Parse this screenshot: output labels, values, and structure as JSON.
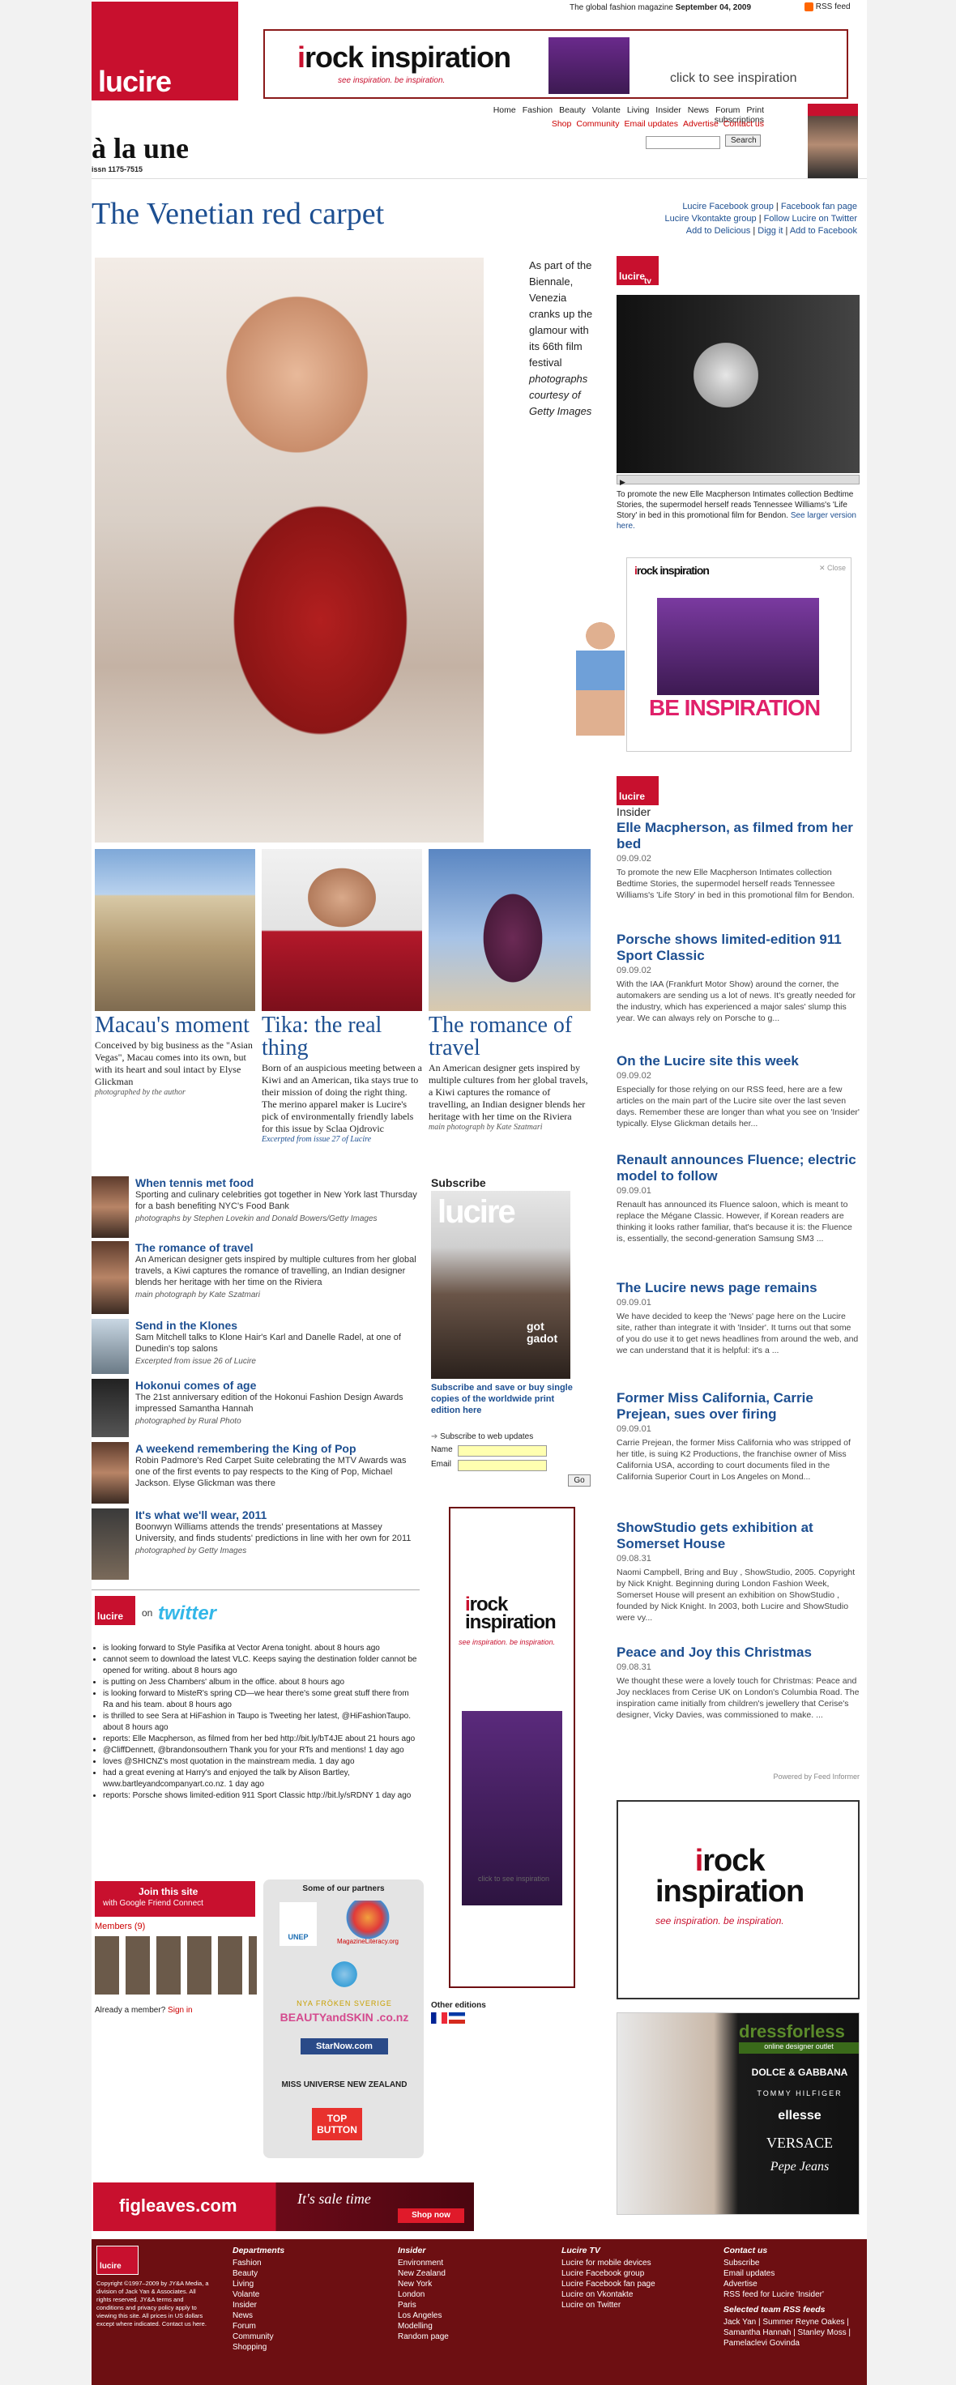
{
  "header": {
    "tagline": "The global fashion magazine",
    "date": "September 04, 2009",
    "rss": "RSS feed",
    "logo": "lucire",
    "section_title": "à la une",
    "issn": "issn 1175-7515"
  },
  "top_ad": {
    "title_a": "rock",
    "title_i": "i",
    "title_b": "inspiration",
    "sub": "see inspiration. be inspiration.",
    "cta": "click to see inspiration"
  },
  "nav": [
    "Home",
    "Fashion",
    "Beauty",
    "Volante",
    "Living",
    "Insider",
    "News",
    "Forum",
    "Print subscriptions"
  ],
  "subnav": [
    "Shop",
    "Community",
    "Email updates",
    "Advertise",
    "Contact us"
  ],
  "search": {
    "placeholder": "",
    "button": "Search"
  },
  "feature": {
    "title": "The Venetian red carpet",
    "caption": "As part of the Biennale, Venezia cranks up the glamour with its 66th film festival",
    "credit": "photographs courtesy of Getty Images"
  },
  "share": [
    "Lucire Facebook group",
    "Facebook fan page",
    "Lucire Vkontakte group",
    "Follow Lucire on Twitter",
    "Add to Delicious",
    "Digg it",
    "Add to Facebook"
  ],
  "tv": {
    "logo": "lucire",
    "label": "tv",
    "desc": "To promote the new Elle Macpherson Intimates collection Bedtime Stories, the supermodel herself reads Tennessee Williams's 'Life Story' in bed in this promotional film for Bendon.",
    "link": "See larger version here."
  },
  "anim_ad": {
    "close": "Close",
    "big": "BE INSPIRATION"
  },
  "insider": {
    "logo": "lucire",
    "label": "Insider",
    "stories": [
      {
        "title": "Elle Macpherson, as filmed from her bed",
        "date": "09.09.02",
        "text": "To promote the new Elle Macpherson Intimates collection Bedtime Stories, the supermodel herself reads Tennessee Williams's 'Life Story' in bed in this promotional film for Bendon."
      },
      {
        "title": "Porsche shows limited-edition 911 Sport Classic",
        "date": "09.09.02",
        "text": "With the IAA (Frankfurt Motor Show) around the corner, the automakers are sending us a lot of news. It's greatly needed for the industry, which has experienced a major sales' slump this year.    We can always rely on Porsche to g..."
      },
      {
        "title": "On the Lucire site this week",
        "date": "09.09.02",
        "text": "Especially for those relying on our RSS feed, here are a few articles on the main part of the Lucire site over the last seven days. Remember these are longer than what you see on 'Insider' typically.    Elyse Glickman details her..."
      },
      {
        "title": "Renault announces Fluence; electric model to follow",
        "date": "09.09.01",
        "text": "Renault has announced its Fluence saloon, which is meant to replace the Mégane Classic. However, if Korean readers are thinking it looks rather familiar, that's because it is: the Fluence is, essentially, the second-generation Samsung SM3 ..."
      },
      {
        "title": "The Lucire news page remains",
        "date": "09.09.01",
        "text": "We have decided to keep the 'News' page here on the Lucire site, rather than integrate it with 'Insider'. It turns out that some of you do use it to get news headlines from around the web, and we can understand that it is helpful: it's a ..."
      },
      {
        "title": "Former Miss California, Carrie Prejean, sues over firing",
        "date": "09.09.01",
        "text": "Carrie Prejean, the former Miss California who was stripped of her title, is suing K2 Productions, the franchise owner of Miss California USA, according to court documents filed in the California Superior Court in Los Angeles on Mond..."
      },
      {
        "title": "ShowStudio gets exhibition at Somerset House",
        "date": "09.08.31",
        "text": "Naomi Campbell, Bring and Buy , ShowStudio, 2005. Copyright by Nick Knight. Beginning during London Fashion Week, Somerset House will present an exhibition on ShowStudio , founded by Nick Knight. In 2003, both Lucire and ShowStudio were vy..."
      },
      {
        "title": "Peace and Joy this Christmas",
        "date": "09.08.31",
        "text": "We thought these were a lovely touch for Christmas: Peace and Joy necklaces from Cerise UK on London's Columbia Road. The inspiration came initially from children's jewellery that Cerise's designer, Vicky Davies, was commissioned to make. ..."
      }
    ],
    "powered": "Powered by Feed Informer"
  },
  "teasers": [
    {
      "title": "Macau's moment",
      "text": "Conceived by big business as the \"Asian Vegas\", Macau comes into its own, but with its heart and soul intact by Elyse Glickman",
      "credit": "photographed by the author"
    },
    {
      "title": "Tika: the real thing",
      "text": "Born of an auspicious meeting between a Kiwi and an American, tika stays true to their mission of doing the right thing. The merino apparel maker is Lucire's pick of environmentally friendly labels for this issue by Sclaa Ojdrovic",
      "credit": "Excerpted from issue 27 of Lucire"
    },
    {
      "title": "The romance of travel",
      "text": "An American designer gets inspired by multiple cultures from her global travels, a Kiwi captures the romance of travelling, an Indian designer blends her heritage with her time on the Riviera",
      "credit": "main photograph by Kate Szatmari"
    }
  ],
  "news": [
    {
      "title": "When tennis met food",
      "text": "Sporting and culinary celebrities got together in New York last Thursday for a bash benefiting NYC's Food Bank",
      "credit": "photographs by Stephen Lovekin and Donald Bowers/Getty Images"
    },
    {
      "title": "The romance of travel",
      "text": "An American designer gets inspired by multiple cultures from her global travels, a Kiwi captures the romance of travelling, an Indian designer blends her heritage with her time on the Riviera",
      "credit": "main photograph by Kate Szatmari"
    },
    {
      "title": "Send in the Klones",
      "text": "Sam Mitchell talks to Klone Hair's Karl and Danelle Radel, at one of Dunedin's top salons",
      "credit": "Excerpted from issue 26 of Lucire"
    },
    {
      "title": "Hokonui comes of age",
      "text": "The 21st anniversary edition of the Hokonui Fashion Design Awards impressed Samantha Hannah",
      "credit": "photographed by Rural Photo"
    },
    {
      "title": "A weekend remembering the King of Pop",
      "text": "Robin Padmore's Red Carpet Suite celebrating the MTV Awards was one of the first events to pay respects to the King of Pop, Michael Jackson. Elyse Glickman was there",
      "credit": ""
    },
    {
      "title": "It's what we'll wear, 2011",
      "text": "Boonwyn Williams attends the trends' presentations at Massey University, and finds students' predictions in line with her own for 2011",
      "credit": "photographed by Getty Images"
    }
  ],
  "subscribe": {
    "label": "Subscribe",
    "cover_logo": "lucire",
    "cover_text": "got gadot",
    "text": "Subscribe and save or buy single copies of the worldwide print edition here",
    "updates": "Subscribe to web updates",
    "name": "Name",
    "email": "Email",
    "go": "Go"
  },
  "twitter": {
    "logo": "lucire",
    "on": "on",
    "brand": "twitter",
    "items": [
      "is looking forward to Style Pasifika at Vector Arena tonight. about 8 hours ago",
      "cannot seem to download the latest VLC. Keeps saying the destination folder cannot be opened for writing. about 8 hours ago",
      "is putting on Jess Chambers' album in the office. about 8 hours ago",
      "is looking forward to MisteR's spring CD—we hear there's some great stuff there from Ra and his team. about 8 hours ago",
      "is thrilled to see Sera at HiFashion in Taupo is Tweeting her latest, @HiFashionTaupo. about 8 hours ago",
      "reports: Elle Macpherson, as filmed from her bed http://bit.ly/bT4JE about 21 hours ago",
      "@CliffDennett, @brandonsouthern Thank you for your RTs and mentions! 1 day ago",
      "loves @SHICNZ's most quotation in the mainstream media. 1 day ago",
      "had a great evening at Harry's and enjoyed the talk by Alison Bartley, www.bartleyandcompanyart.co.nz. 1 day ago",
      "reports: Porsche shows limited-edition 911 Sport Classic http://bit.ly/sRDNY 1 day ago"
    ]
  },
  "gfc": {
    "join": "Join this site",
    "with": "with Google Friend Connect",
    "members": "Members (9)",
    "already": "Already a member?",
    "signin": "Sign in"
  },
  "partners": {
    "title": "Some of our partners",
    "items": [
      "UNEP",
      "MagazineLiteracy.org",
      "NYA FRÖKEN SVERIGE",
      "BEAUTYandSKIN .co.nz",
      "StarNow.com",
      "MISS UNIVERSE NEW ZEALAND",
      "TOP BUTTON"
    ]
  },
  "other": {
    "label": "Other editions"
  },
  "mid_ad": {
    "cta": "click to see inspiration"
  },
  "bottom_ads": {
    "dfl": "dressforless",
    "dfl_sub": "online designer outlet",
    "brands": [
      "DOLCE & GABBANA",
      "TOMMY HILFIGER",
      "ellesse",
      "VERSACE",
      "Pepe Jeans"
    ],
    "fig": "figleaves.com",
    "fig_sale": "It's sale time",
    "fig_shop": "Shop now"
  },
  "footer": {
    "logo": "lucire",
    "copy": "Copyright ©1997–2009 by JY&A Media, a division of Jack Yan & Associates. All rights reserved. JY&A terms and conditions and privacy policy apply to viewing this site. All prices in US dollars except where indicated. Contact us here.",
    "cols": [
      {
        "h": "Departments",
        "items": [
          "Fashion",
          "Beauty",
          "Living",
          "Volante",
          "Insider",
          "News",
          "Forum",
          "Community",
          "Shopping"
        ]
      },
      {
        "h": "Insider",
        "items": [
          "Environment",
          "New Zealand",
          "New York",
          "London",
          "Paris",
          "Los Angeles",
          "Modelling",
          "Random page"
        ]
      },
      {
        "h": "Lucire TV",
        "items": [
          "Lucire for mobile devices",
          "Lucire Facebook group",
          "Lucire Facebook fan page",
          "Lucire on Vkontakte",
          "Lucire on Twitter"
        ]
      },
      {
        "h": "Contact us",
        "items": [
          "Subscribe",
          "Email updates",
          "Advertise",
          "RSS feed for Lucire 'Insider'"
        ]
      }
    ],
    "team_h": "Selected team RSS feeds",
    "team": "Jack Yan | Summer Reyne Oakes | Samantha Hannah | Stanley Moss | Pamelaclevi Govinda"
  },
  "colors": {
    "brand": "#c8102e",
    "link": "#1d4f91",
    "footer": "#6d0f12"
  }
}
